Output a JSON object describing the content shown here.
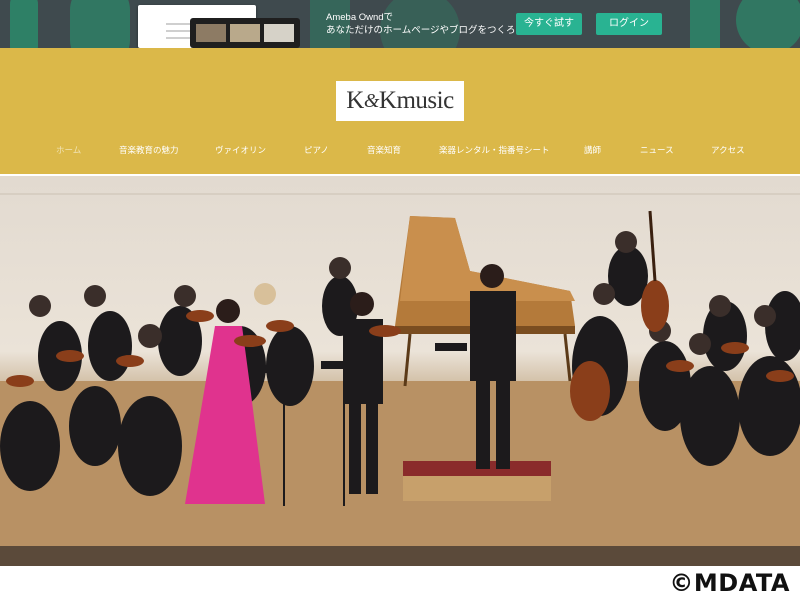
{
  "promo": {
    "line1": "Ameba Owndで",
    "line2": "あなただけのホームページやブログをつくろう",
    "try_label": "今すぐ試す",
    "login_label": "ログイン"
  },
  "site": {
    "logo_part1": "K",
    "logo_and": "&",
    "logo_part2": "Kmusic"
  },
  "nav": {
    "items": [
      {
        "label": "ホーム"
      },
      {
        "label": "音楽教育の魅力"
      },
      {
        "label": "ヴァイオリン"
      },
      {
        "label": "ピアノ"
      },
      {
        "label": "音楽知育"
      },
      {
        "label": "楽器レンタル・指番号シート"
      },
      {
        "label": "講師"
      },
      {
        "label": "ニュース"
      },
      {
        "label": "アクセス"
      }
    ]
  },
  "watermark": "©MDATA",
  "colors": {
    "promo_bg": "#3f4a4e",
    "promo_button": "#29b392",
    "header_bg": "#dbb849",
    "soloist_dress": "#e0338e"
  }
}
